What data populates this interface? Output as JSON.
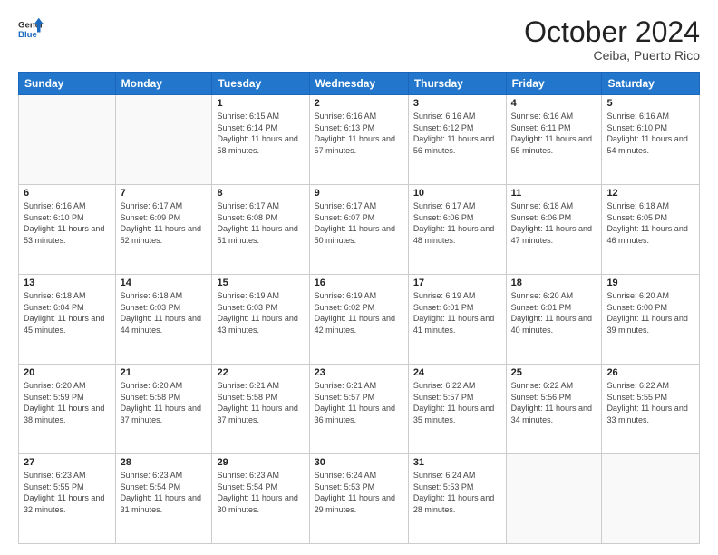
{
  "header": {
    "logo_general": "General",
    "logo_blue": "Blue",
    "month_title": "October 2024",
    "subtitle": "Ceiba, Puerto Rico"
  },
  "days_of_week": [
    "Sunday",
    "Monday",
    "Tuesday",
    "Wednesday",
    "Thursday",
    "Friday",
    "Saturday"
  ],
  "weeks": [
    [
      {
        "day": "",
        "sunrise": "",
        "sunset": "",
        "daylight": ""
      },
      {
        "day": "",
        "sunrise": "",
        "sunset": "",
        "daylight": ""
      },
      {
        "day": "1",
        "sunrise": "Sunrise: 6:15 AM",
        "sunset": "Sunset: 6:14 PM",
        "daylight": "Daylight: 11 hours and 58 minutes."
      },
      {
        "day": "2",
        "sunrise": "Sunrise: 6:16 AM",
        "sunset": "Sunset: 6:13 PM",
        "daylight": "Daylight: 11 hours and 57 minutes."
      },
      {
        "day": "3",
        "sunrise": "Sunrise: 6:16 AM",
        "sunset": "Sunset: 6:12 PM",
        "daylight": "Daylight: 11 hours and 56 minutes."
      },
      {
        "day": "4",
        "sunrise": "Sunrise: 6:16 AM",
        "sunset": "Sunset: 6:11 PM",
        "daylight": "Daylight: 11 hours and 55 minutes."
      },
      {
        "day": "5",
        "sunrise": "Sunrise: 6:16 AM",
        "sunset": "Sunset: 6:10 PM",
        "daylight": "Daylight: 11 hours and 54 minutes."
      }
    ],
    [
      {
        "day": "6",
        "sunrise": "Sunrise: 6:16 AM",
        "sunset": "Sunset: 6:10 PM",
        "daylight": "Daylight: 11 hours and 53 minutes."
      },
      {
        "day": "7",
        "sunrise": "Sunrise: 6:17 AM",
        "sunset": "Sunset: 6:09 PM",
        "daylight": "Daylight: 11 hours and 52 minutes."
      },
      {
        "day": "8",
        "sunrise": "Sunrise: 6:17 AM",
        "sunset": "Sunset: 6:08 PM",
        "daylight": "Daylight: 11 hours and 51 minutes."
      },
      {
        "day": "9",
        "sunrise": "Sunrise: 6:17 AM",
        "sunset": "Sunset: 6:07 PM",
        "daylight": "Daylight: 11 hours and 50 minutes."
      },
      {
        "day": "10",
        "sunrise": "Sunrise: 6:17 AM",
        "sunset": "Sunset: 6:06 PM",
        "daylight": "Daylight: 11 hours and 48 minutes."
      },
      {
        "day": "11",
        "sunrise": "Sunrise: 6:18 AM",
        "sunset": "Sunset: 6:06 PM",
        "daylight": "Daylight: 11 hours and 47 minutes."
      },
      {
        "day": "12",
        "sunrise": "Sunrise: 6:18 AM",
        "sunset": "Sunset: 6:05 PM",
        "daylight": "Daylight: 11 hours and 46 minutes."
      }
    ],
    [
      {
        "day": "13",
        "sunrise": "Sunrise: 6:18 AM",
        "sunset": "Sunset: 6:04 PM",
        "daylight": "Daylight: 11 hours and 45 minutes."
      },
      {
        "day": "14",
        "sunrise": "Sunrise: 6:18 AM",
        "sunset": "Sunset: 6:03 PM",
        "daylight": "Daylight: 11 hours and 44 minutes."
      },
      {
        "day": "15",
        "sunrise": "Sunrise: 6:19 AM",
        "sunset": "Sunset: 6:03 PM",
        "daylight": "Daylight: 11 hours and 43 minutes."
      },
      {
        "day": "16",
        "sunrise": "Sunrise: 6:19 AM",
        "sunset": "Sunset: 6:02 PM",
        "daylight": "Daylight: 11 hours and 42 minutes."
      },
      {
        "day": "17",
        "sunrise": "Sunrise: 6:19 AM",
        "sunset": "Sunset: 6:01 PM",
        "daylight": "Daylight: 11 hours and 41 minutes."
      },
      {
        "day": "18",
        "sunrise": "Sunrise: 6:20 AM",
        "sunset": "Sunset: 6:01 PM",
        "daylight": "Daylight: 11 hours and 40 minutes."
      },
      {
        "day": "19",
        "sunrise": "Sunrise: 6:20 AM",
        "sunset": "Sunset: 6:00 PM",
        "daylight": "Daylight: 11 hours and 39 minutes."
      }
    ],
    [
      {
        "day": "20",
        "sunrise": "Sunrise: 6:20 AM",
        "sunset": "Sunset: 5:59 PM",
        "daylight": "Daylight: 11 hours and 38 minutes."
      },
      {
        "day": "21",
        "sunrise": "Sunrise: 6:20 AM",
        "sunset": "Sunset: 5:58 PM",
        "daylight": "Daylight: 11 hours and 37 minutes."
      },
      {
        "day": "22",
        "sunrise": "Sunrise: 6:21 AM",
        "sunset": "Sunset: 5:58 PM",
        "daylight": "Daylight: 11 hours and 37 minutes."
      },
      {
        "day": "23",
        "sunrise": "Sunrise: 6:21 AM",
        "sunset": "Sunset: 5:57 PM",
        "daylight": "Daylight: 11 hours and 36 minutes."
      },
      {
        "day": "24",
        "sunrise": "Sunrise: 6:22 AM",
        "sunset": "Sunset: 5:57 PM",
        "daylight": "Daylight: 11 hours and 35 minutes."
      },
      {
        "day": "25",
        "sunrise": "Sunrise: 6:22 AM",
        "sunset": "Sunset: 5:56 PM",
        "daylight": "Daylight: 11 hours and 34 minutes."
      },
      {
        "day": "26",
        "sunrise": "Sunrise: 6:22 AM",
        "sunset": "Sunset: 5:55 PM",
        "daylight": "Daylight: 11 hours and 33 minutes."
      }
    ],
    [
      {
        "day": "27",
        "sunrise": "Sunrise: 6:23 AM",
        "sunset": "Sunset: 5:55 PM",
        "daylight": "Daylight: 11 hours and 32 minutes."
      },
      {
        "day": "28",
        "sunrise": "Sunrise: 6:23 AM",
        "sunset": "Sunset: 5:54 PM",
        "daylight": "Daylight: 11 hours and 31 minutes."
      },
      {
        "day": "29",
        "sunrise": "Sunrise: 6:23 AM",
        "sunset": "Sunset: 5:54 PM",
        "daylight": "Daylight: 11 hours and 30 minutes."
      },
      {
        "day": "30",
        "sunrise": "Sunrise: 6:24 AM",
        "sunset": "Sunset: 5:53 PM",
        "daylight": "Daylight: 11 hours and 29 minutes."
      },
      {
        "day": "31",
        "sunrise": "Sunrise: 6:24 AM",
        "sunset": "Sunset: 5:53 PM",
        "daylight": "Daylight: 11 hours and 28 minutes."
      },
      {
        "day": "",
        "sunrise": "",
        "sunset": "",
        "daylight": ""
      },
      {
        "day": "",
        "sunrise": "",
        "sunset": "",
        "daylight": ""
      }
    ]
  ]
}
